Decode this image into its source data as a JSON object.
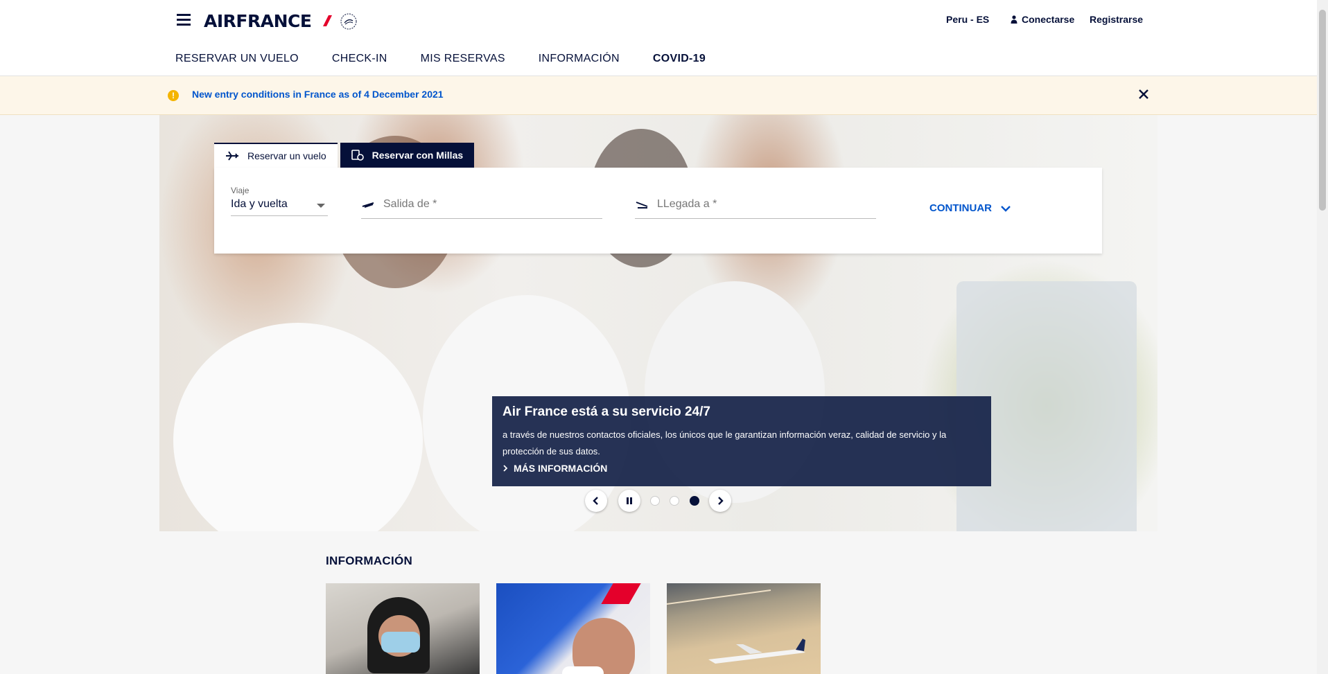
{
  "header": {
    "logo_text": "AIRFRANCE",
    "region": "Peru - ES",
    "login_label": "Conectarse",
    "register_label": "Registrarse",
    "nav": [
      {
        "label": "RESERVAR UN VUELO"
      },
      {
        "label": "CHECK-IN"
      },
      {
        "label": "MIS RESERVAS"
      },
      {
        "label": "INFORMACIÓN"
      },
      {
        "label": "COVID-19"
      }
    ]
  },
  "alert": {
    "text": "New entry conditions in France as of 4 December 2021",
    "icon": "warning-icon"
  },
  "booking": {
    "tabs": [
      {
        "label": "Reservar un vuelo",
        "icon": "plane-icon"
      },
      {
        "label": "Reservar con Millas",
        "icon": "miles-icon"
      }
    ],
    "trip_label": "Viaje",
    "trip_value": "Ida y vuelta",
    "from_placeholder": "Salida de *",
    "to_placeholder": "LLegada a *",
    "continue_label": "CONTINUAR"
  },
  "promo": {
    "title": "Air France está a su servicio 24/7",
    "text": "a través de nuestros contactos oficiales, los únicos que le garantizan información veraz, calidad de servicio y la protección de sus datos.",
    "link": "MÁS INFORMACIÓN"
  },
  "carousel": {
    "slides": 3,
    "active_slide": 3
  },
  "info": {
    "title": "INFORMACIÓN"
  },
  "colors": {
    "brand_navy": "#051039",
    "link_blue": "#0055cc",
    "alert_bg": "#fdf6e9",
    "brand_red": "#e4002b"
  }
}
